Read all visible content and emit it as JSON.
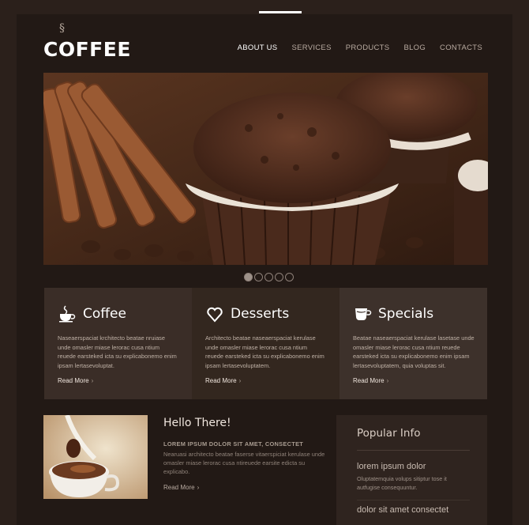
{
  "brand": {
    "name": "COFFEE"
  },
  "nav": {
    "items": [
      {
        "label": "ABOUT US",
        "active": true
      },
      {
        "label": "SERVICES",
        "active": false
      },
      {
        "label": "PRODUCTS",
        "active": false
      },
      {
        "label": "BLOG",
        "active": false
      },
      {
        "label": "CONTACTS",
        "active": false
      }
    ]
  },
  "slider": {
    "dots": 5,
    "active_index": 0
  },
  "features": [
    {
      "icon": "coffee-cup-icon",
      "title": "Coffee",
      "text": "Naseaerspaciat krchitecto beatae nruiase unde omasler miase lerorac cusa ntium reuede earsteked icta su explicabonemo enim ipsam lertasevoluptat.",
      "more": "Read More"
    },
    {
      "icon": "heart-icon",
      "title": "Desserts",
      "text": "Architecto beatae naseaerspaciat kerulase unde omasler miase lerorac cusa ntium reuede earsteked icta su explicabonemo enim ipsam lertasevoluptatem.",
      "more": "Read More"
    },
    {
      "icon": "mug-icon",
      "title": "Specials",
      "text": "Beatae naseaerspaciat kerulase lasetase unde omasler miase lerorac cusa ntium reuede earsteked icta su explicabonemo enim ipsam lertasevoluptatem, quia voluptas sit.",
      "more": "Read More"
    }
  ],
  "hello": {
    "title": "Hello There!",
    "subtitle": "LOREM IPSUM DOLOR SIT AMET, CONSECTET",
    "text": "Nearuasi architecto beatae faserse vitaerspiciat kerulase unde omasler miase lerorac cusa ntireuede earsite edicta su explicabo.",
    "more": "Read More"
  },
  "popular": {
    "title": "Popular Info",
    "items": [
      {
        "title": "lorem ipsum dolor",
        "text": "Oluptatemquia volups sitiptur tose it autfugise consequuntur."
      },
      {
        "title": "dolor sit amet consectet"
      }
    ]
  },
  "colors": {
    "background": "#2b201b",
    "panel": "#221915",
    "accent": "#ffffff"
  }
}
